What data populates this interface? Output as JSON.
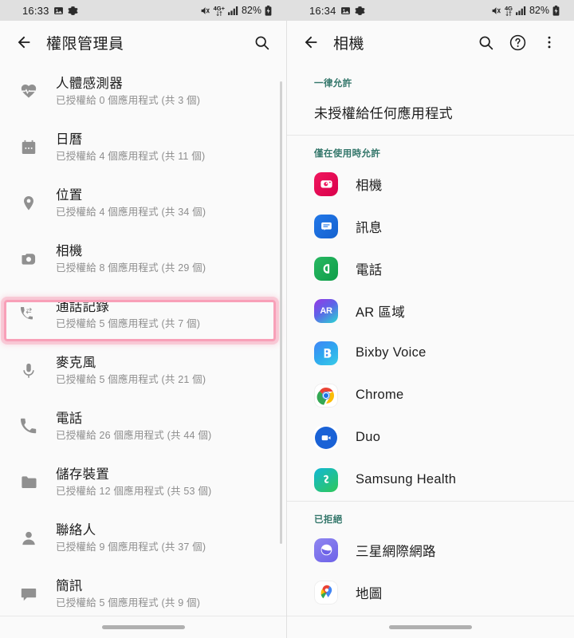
{
  "left": {
    "status": {
      "time": "16:33",
      "battery": "82%",
      "network_label": "4G+",
      "icons": [
        "image-icon",
        "gear-icon",
        "mute-icon",
        "network-4g-icon",
        "signal-bars-icon",
        "battery-icon"
      ]
    },
    "appbar": {
      "title": "權限管理員",
      "back": "back-arrow",
      "search": "search-icon"
    },
    "permissions": [
      {
        "icon": "body-sensor-icon",
        "title": "人體感測器",
        "subtitle": "已授權給 0 個應用程式 (共 3 個)",
        "highlighted": false
      },
      {
        "icon": "calendar-icon",
        "title": "日曆",
        "subtitle": "已授權給 4 個應用程式 (共 11 個)",
        "highlighted": false
      },
      {
        "icon": "location-pin-icon",
        "title": "位置",
        "subtitle": "已授權給 4 個應用程式 (共 34 個)",
        "highlighted": false
      },
      {
        "icon": "camera-icon",
        "title": "相機",
        "subtitle": "已授權給 8 個應用程式 (共 29 個)",
        "highlighted": true
      },
      {
        "icon": "call-log-icon",
        "title": "通話記錄",
        "subtitle": "已授權給 5 個應用程式 (共 7 個)",
        "highlighted": false
      },
      {
        "icon": "microphone-icon",
        "title": "麥克風",
        "subtitle": "已授權給 5 個應用程式 (共 21 個)",
        "highlighted": false
      },
      {
        "icon": "phone-icon",
        "title": "電話",
        "subtitle": "已授權給 26 個應用程式 (共 44 個)",
        "highlighted": false
      },
      {
        "icon": "folder-icon",
        "title": "儲存裝置",
        "subtitle": "已授權給 12 個應用程式 (共 53 個)",
        "highlighted": false
      },
      {
        "icon": "contact-icon",
        "title": "聯絡人",
        "subtitle": "已授權給 9 個應用程式 (共 37 個)",
        "highlighted": false
      },
      {
        "icon": "sms-icon",
        "title": "簡訊",
        "subtitle": "已授權給 5 個應用程式 (共 9 個)",
        "highlighted": false
      }
    ],
    "highlight_color": "#f8a0b8"
  },
  "right": {
    "status": {
      "time": "16:34",
      "battery": "82%",
      "network_label": "4G"
    },
    "appbar": {
      "title": "相機",
      "back": "back-arrow",
      "search": "search-icon",
      "help": "help-circle-icon",
      "overflow": "more-vertical-icon"
    },
    "section_color": "#34776b",
    "sections": [
      {
        "header": "一律允許",
        "empty_text": "未授權給任何應用程式",
        "apps": []
      },
      {
        "header": "僅在使用時允許",
        "empty_text": "",
        "apps": [
          {
            "name": "相機",
            "icon": "samsung-camera-icon"
          },
          {
            "name": "訊息",
            "icon": "samsung-messages-icon"
          },
          {
            "name": "電話",
            "icon": "samsung-phone-icon"
          },
          {
            "name": "AR 區域",
            "icon": "ar-zone-icon"
          },
          {
            "name": "Bixby Voice",
            "icon": "bixby-voice-icon"
          },
          {
            "name": "Chrome",
            "icon": "chrome-icon"
          },
          {
            "name": "Duo",
            "icon": "google-duo-icon"
          },
          {
            "name": "Samsung Health",
            "icon": "samsung-health-icon"
          }
        ]
      },
      {
        "header": "已拒絕",
        "empty_text": "",
        "apps": [
          {
            "name": "三星網際網路",
            "icon": "samsung-internet-icon"
          },
          {
            "name": "地圖",
            "icon": "google-maps-icon"
          }
        ]
      }
    ]
  }
}
